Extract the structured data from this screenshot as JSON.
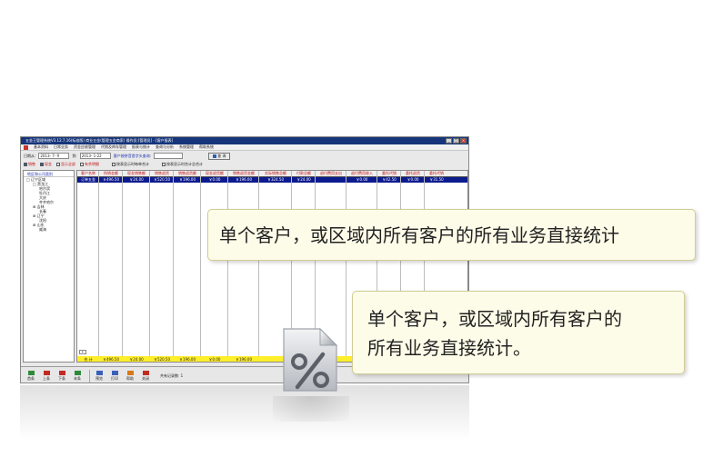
{
  "app": {
    "title": "五金王管理系统V3.12.7.16(标准版)  商业五金(管理五金商家)  操作员:[管理员] - [客户报表]",
    "menu": [
      "基本资料",
      "日常业务",
      "资金应收管理",
      "代销及库存管理",
      "报表与统计",
      "查询与分析",
      "系统管理",
      "帮助系统"
    ],
    "filters": {
      "date_from_label": "日期从:",
      "date_from": "2013- 7- 9",
      "date_to_label": "到:",
      "date_to": "2013- 1-22",
      "customer_search_label": "客户按拼音首字头查询:",
      "customer_search_value": "",
      "query_button": "查 询"
    },
    "options": {
      "sales": "销售",
      "cash": "现金",
      "show_all": "显示全部",
      "has_detail": "有余明细",
      "print_by_customer": "按表显示时每单合计",
      "print_by_product": "按表显示时合计总合计"
    },
    "tree": {
      "header": "地区和公司类别",
      "items": [
        {
          "label": "□ 辽宁区域",
          "indent": 0
        },
        {
          "label": "□ 黑龙江",
          "indent": 1
        },
        {
          "label": "哈尔滨",
          "indent": 2
        },
        {
          "label": "牡丹江",
          "indent": 2
        },
        {
          "label": "大庆",
          "indent": 2
        },
        {
          "label": "齐齐哈尔",
          "indent": 2
        },
        {
          "label": "⊞ 吉林",
          "indent": 1
        },
        {
          "label": "长春",
          "indent": 2
        },
        {
          "label": "⊞ 辽宁",
          "indent": 1
        },
        {
          "label": "沈阳",
          "indent": 2
        },
        {
          "label": "⊞ 山东",
          "indent": 1
        },
        {
          "label": "威海",
          "indent": 2
        }
      ]
    },
    "grid": {
      "columns": [
        "客户名称",
        "所销金额",
        "现金销售额",
        "销售退货",
        "销售退货额",
        "现金退货额",
        "销售退货金额",
        "实际销售总额",
        "付款总额",
        "退付费用支出",
        "退付费用收入",
        "委托代销",
        "委托退货",
        "委托代销"
      ],
      "row1": [
        "订单五金",
        "￥496.50",
        "￥24.00",
        "￥520.50",
        "￥196.00",
        "￥0.00",
        "￥196.00",
        "￥324.50",
        "￥24.00",
        "",
        "￥0.00",
        "￥42.50",
        "￥0.00",
        "￥31.50"
      ],
      "total": [
        "合 计",
        "￥496.50",
        "￥24.00",
        "￥520.50",
        "￥196.00",
        "￥0.00",
        "￥196.00",
        "",
        "",
        "",
        "",
        "",
        "",
        ""
      ]
    },
    "toolbar": {
      "buttons": [
        "首条",
        "上条",
        "下条",
        "末条",
        "预览",
        "打印",
        "帮助",
        "关闭"
      ],
      "record_count": "共有记录数: 1"
    }
  },
  "callouts": {
    "first": "单个客户，或区域内所有客户的所有业务直接统计",
    "second_line1": "单个客户，或区域内所有客户的",
    "second_line2": "所有业务直接统计。"
  },
  "icon": {
    "name": "percent-icon",
    "color": "#c9ccd1"
  }
}
